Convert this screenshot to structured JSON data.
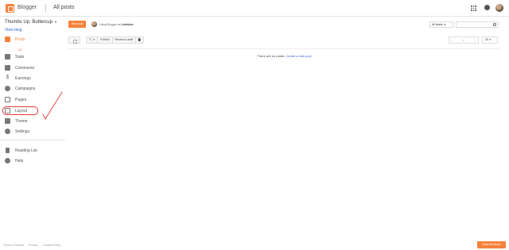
{
  "header": {
    "brand": "Blogger",
    "page_title": "All posts"
  },
  "sidebar": {
    "blog_name": "Thumbs Up, Buttercup",
    "view_blog": "View blog",
    "items": [
      {
        "label": "Posts",
        "icon": "posts-icon"
      },
      {
        "label": "Stats",
        "icon": "stats-icon"
      },
      {
        "label": "Comments",
        "icon": "comments-icon"
      },
      {
        "label": "Earnings",
        "icon": "dollar-icon"
      },
      {
        "label": "Campaigns",
        "icon": "campaigns-icon"
      },
      {
        "label": "Pages",
        "icon": "pages-icon"
      },
      {
        "label": "Layout",
        "icon": "layout-icon"
      },
      {
        "label": "Theme",
        "icon": "theme-icon"
      },
      {
        "label": "Settings",
        "icon": "gear-icon"
      }
    ],
    "posts_sub": "All",
    "secondary": [
      {
        "label": "Reading List",
        "icon": "bookmark-icon"
      },
      {
        "label": "Help",
        "icon": "help-icon"
      }
    ],
    "footer": [
      "Terms of Service",
      "Privacy",
      "Content Policy"
    ]
  },
  "main": {
    "new_post": "New post",
    "using_prefix": "Using Blogger as",
    "using_user": "Livielove",
    "labels_dd": "All labels",
    "toolbar": [
      "Publish",
      "Revert to draft"
    ],
    "pager_page": "1",
    "per_page": "25",
    "empty_text": "There are no posts.",
    "empty_link": "Create a new post"
  },
  "feedback": "Send feedback",
  "colors": {
    "accent": "#f5823b",
    "link": "#3367d6",
    "annotation": "#e53935"
  }
}
